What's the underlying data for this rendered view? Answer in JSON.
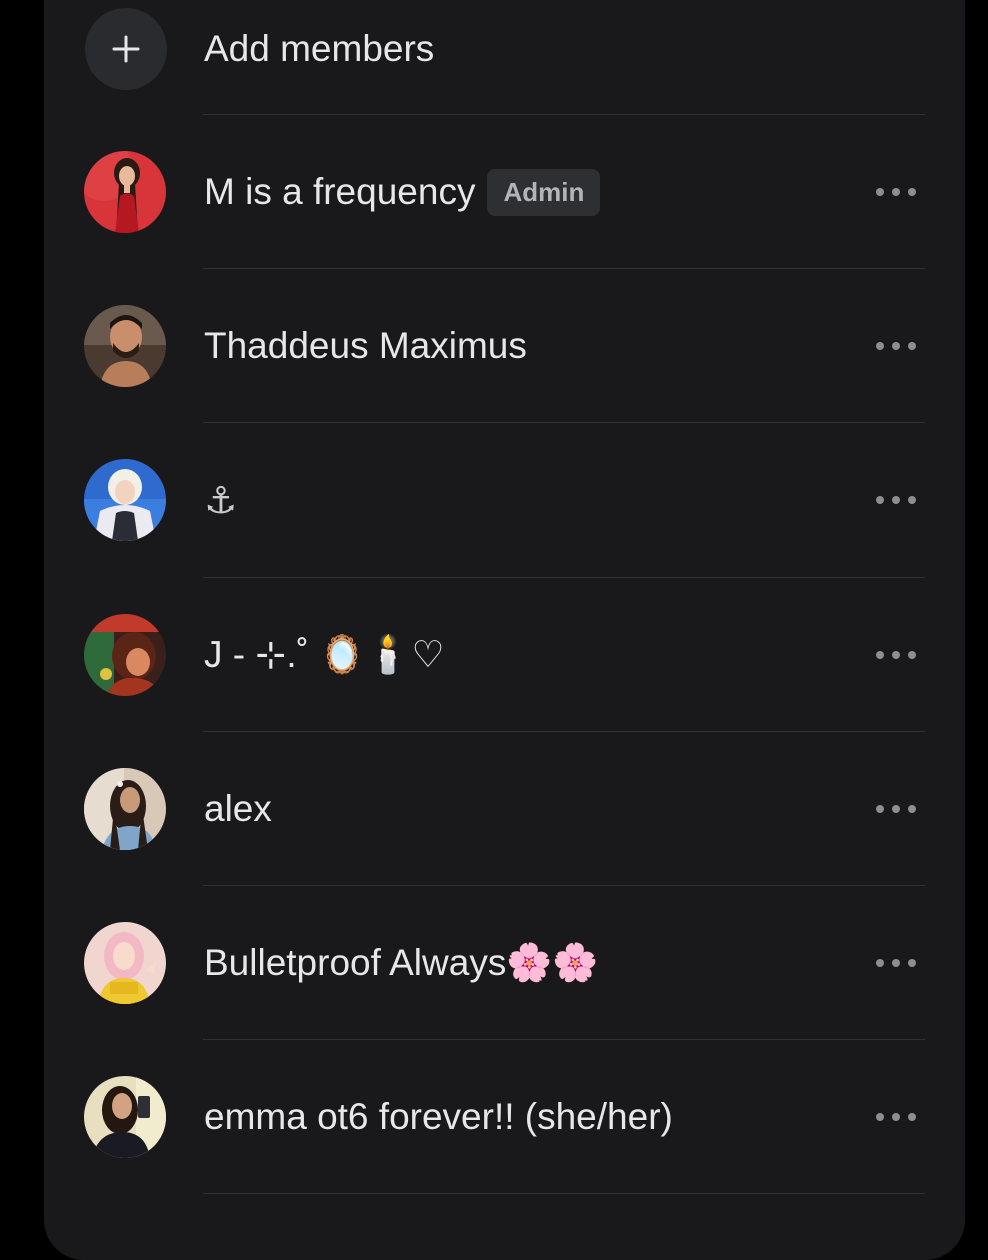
{
  "add_members": {
    "label": "Add members",
    "icon": "plus-icon"
  },
  "members": [
    {
      "name": "M is a frequency",
      "badge": "Admin",
      "avatar": "avatar-red-dress"
    },
    {
      "name": "Thaddeus Maximus",
      "avatar": "avatar-man-beard"
    },
    {
      "name": "⚓",
      "avatar": "avatar-blonde-blue-bg"
    },
    {
      "name": "J - ⊹.˚ 🪞🕯️♡",
      "avatar": "avatar-colorful"
    },
    {
      "name": "alex",
      "avatar": "avatar-long-hair"
    },
    {
      "name": "Bulletproof Always🌸🌸",
      "avatar": "avatar-pink-hair"
    },
    {
      "name": "emma ot6 forever!! (she/her)",
      "avatar": "avatar-mirror-selfie"
    }
  ],
  "more_icon": "more-horizontal-icon",
  "colors": {
    "background": "#000000",
    "panel": "#19191c",
    "text": "#e7e7ea",
    "badge_bg": "#2e2f33",
    "badge_text": "#b3b4b9",
    "divider": "#2f3034"
  }
}
